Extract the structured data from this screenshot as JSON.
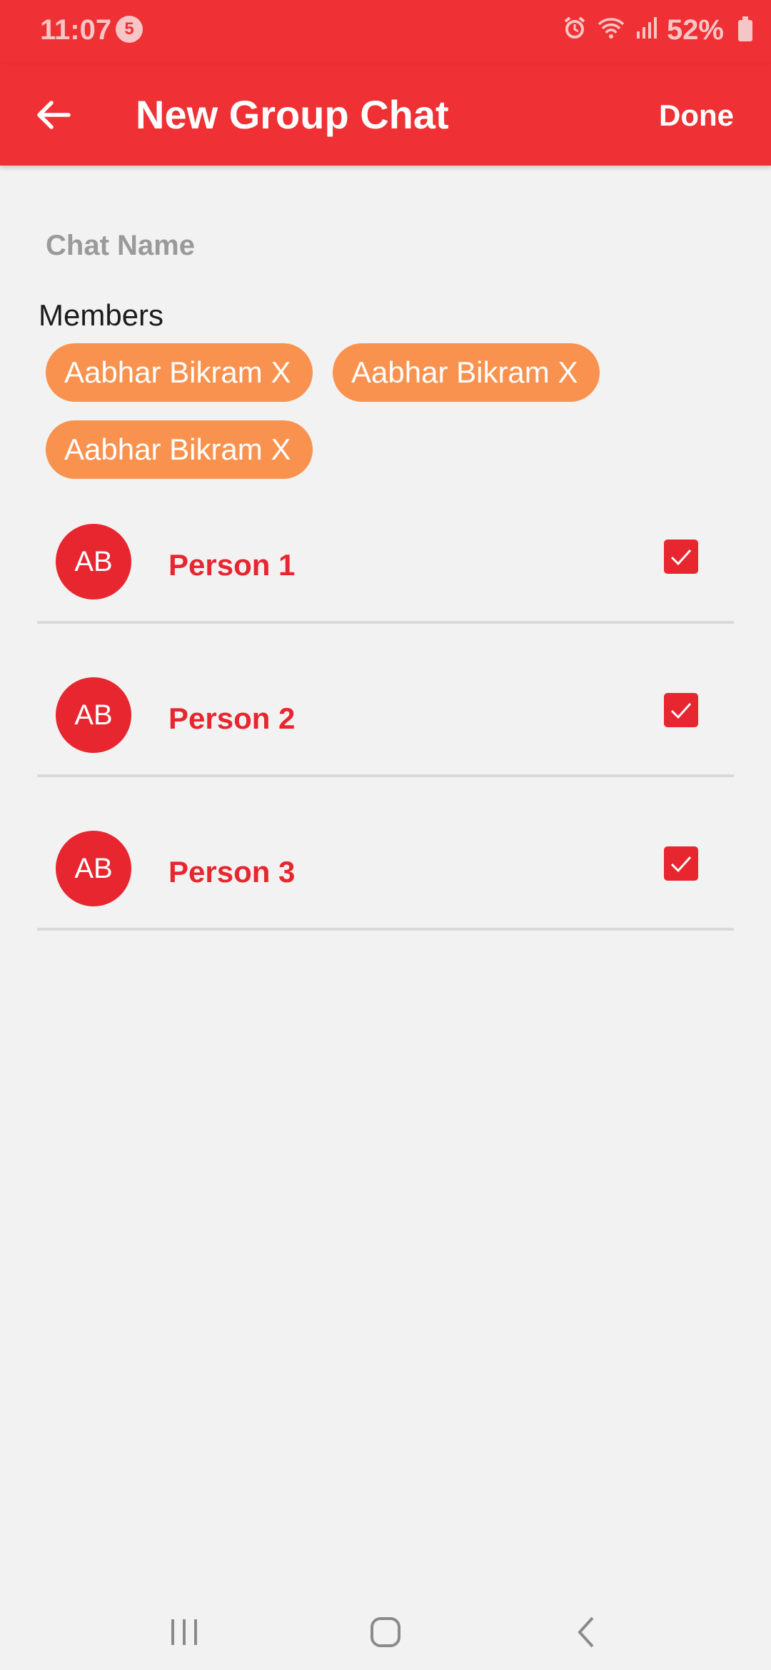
{
  "status_bar": {
    "time": "11:07",
    "notification_count": "5",
    "battery": "52%",
    "icons": [
      "alarm-icon",
      "wifi-icon",
      "signal-icon",
      "battery-icon"
    ]
  },
  "app_bar": {
    "title": "New Group Chat",
    "done_label": "Done",
    "back_icon": "arrow-left-icon",
    "color": "#ef3034"
  },
  "form": {
    "chat_name_placeholder": "Chat Name",
    "chat_name_value": "",
    "members_label": "Members"
  },
  "member_chips": [
    {
      "label": "Aabhar Bikram X"
    },
    {
      "label": "Aabhar Bikram X"
    },
    {
      "label": "Aabhar Bikram X"
    }
  ],
  "people": [
    {
      "initials": "AB",
      "name": "Person 1",
      "checked": true
    },
    {
      "initials": "AB",
      "name": "Person 2",
      "checked": true
    },
    {
      "initials": "AB",
      "name": "Person 3",
      "checked": true
    }
  ],
  "colors": {
    "accent": "#ef3034",
    "chip": "#f9924f",
    "text_accent": "#e8262f"
  },
  "nav_bar": {
    "icons": [
      "recent-apps-icon",
      "home-icon",
      "back-icon"
    ]
  }
}
